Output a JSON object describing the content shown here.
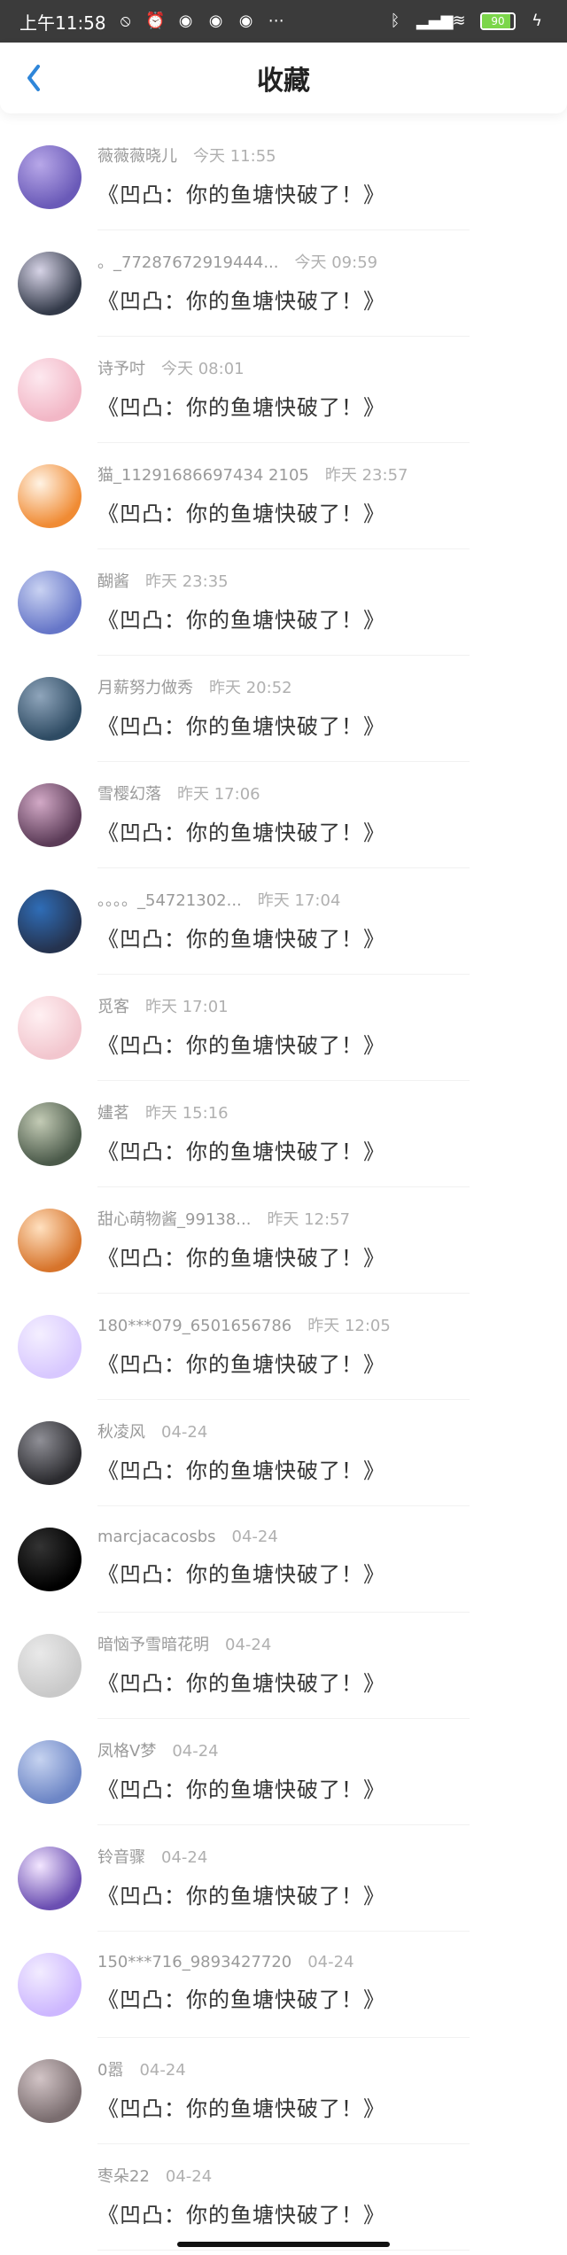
{
  "status_bar": {
    "time": "上午11:58",
    "battery_text": "90",
    "battery_level": 0.9,
    "left_icons": [
      "mute-icon",
      "alarm-icon",
      "app-icon-1",
      "app-icon-2",
      "app-icon-3",
      "more-dots-icon"
    ],
    "right_icons": [
      "bluetooth-icon",
      "signal-hd-icon",
      "wifi-icon",
      "battery-icon",
      "charging-icon"
    ]
  },
  "header": {
    "title": "收藏",
    "back_icon": "chevron-left-icon",
    "accent": "#2f86d9"
  },
  "items": [
    {
      "name": "薇薇薇晓儿",
      "time": "今天 11:55",
      "title": "《凹凸：你的鱼塘快破了！》",
      "avatar_colors": [
        "#6a5ab8",
        "#b7a7e8"
      ]
    },
    {
      "name": "。_77287672919444...",
      "time": "今天 09:59",
      "title": "《凹凸：你的鱼塘快破了！》",
      "avatar_colors": [
        "#333a49",
        "#d6d3e6"
      ]
    },
    {
      "name": "诗予吋",
      "time": "今天 08:01",
      "title": "《凹凸：你的鱼塘快破了！》",
      "avatar_colors": [
        "#f2b7c6",
        "#fde8ef"
      ]
    },
    {
      "name": "猫_11291686697434 2105",
      "time": "昨天 23:57",
      "title": "《凹凸：你的鱼塘快破了！》",
      "avatar_colors": [
        "#f08b34",
        "#fff3e4"
      ]
    },
    {
      "name": "醐酱",
      "time": "昨天 23:35",
      "title": "《凹凸：你的鱼塘快破了！》",
      "avatar_colors": [
        "#6676c8",
        "#c9d2f2"
      ]
    },
    {
      "name": "月薪努力做秀",
      "time": "昨天 20:52",
      "title": "《凹凸：你的鱼塘快破了！》",
      "avatar_colors": [
        "#2e4b63",
        "#8fa5bb"
      ]
    },
    {
      "name": "雪樱幻落",
      "time": "昨天 17:06",
      "title": "《凹凸：你的鱼塘快破了！》",
      "avatar_colors": [
        "#5b3b57",
        "#d2a9c6"
      ]
    },
    {
      "name": "。。。。_54721302...",
      "time": "昨天 17:04",
      "title": "《凹凸：你的鱼塘快破了！》",
      "avatar_colors": [
        "#25334f",
        "#2f6db7"
      ]
    },
    {
      "name": "觅客",
      "time": "昨天 17:01",
      "title": "《凹凸：你的鱼塘快破了！》",
      "avatar_colors": [
        "#f2c6ce",
        "#fff0f2"
      ]
    },
    {
      "name": "嫿茗",
      "time": "昨天 15:16",
      "title": "《凹凸：你的鱼塘快破了！》",
      "avatar_colors": [
        "#4b5a4a",
        "#c3cbb5"
      ]
    },
    {
      "name": "甜心萌物酱_99138...",
      "time": "昨天 12:57",
      "title": "《凹凸：你的鱼塘快破了！》",
      "avatar_colors": [
        "#d7742b",
        "#ffe0bf"
      ]
    },
    {
      "name": "180***079_6501656786",
      "time": "昨天 12:05",
      "title": "《凹凸：你的鱼塘快破了！》",
      "avatar_colors": [
        "#d8c8ff",
        "#f4efff"
      ]
    },
    {
      "name": "秋凌风",
      "time": "04-24",
      "title": "《凹凸：你的鱼塘快破了！》",
      "avatar_colors": [
        "#2b2b2f",
        "#8f8f96"
      ]
    },
    {
      "name": "marcjacacosbs",
      "time": "04-24",
      "title": "《凹凸：你的鱼塘快破了！》",
      "avatar_colors": [
        "#000000",
        "#333333"
      ]
    },
    {
      "name": "暗恼予雪暗花明",
      "time": "04-24",
      "title": "《凹凸：你的鱼塘快破了！》",
      "avatar_colors": [
        "#c9c9c9",
        "#e9e9e9"
      ]
    },
    {
      "name": "凤格V梦",
      "time": "04-24",
      "title": "《凹凸：你的鱼塘快破了！》",
      "avatar_colors": [
        "#6d86c6",
        "#c6d3f0"
      ]
    },
    {
      "name": "铃音骤",
      "time": "04-24",
      "title": "《凹凸：你的鱼塘快破了！》",
      "avatar_colors": [
        "#6b4fb2",
        "#f3e6ff"
      ]
    },
    {
      "name": "150***716_9893427720",
      "time": "04-24",
      "title": "《凹凸：你的鱼塘快破了！》",
      "avatar_colors": [
        "#cdb7ff",
        "#f2ecff"
      ]
    },
    {
      "name": "0嚣",
      "time": "04-24",
      "title": "《凹凸：你的鱼塘快破了！》",
      "avatar_colors": [
        "#7a6d6f",
        "#d2c4c6"
      ]
    },
    {
      "name": "枣朵22",
      "time": "04-24",
      "title": "《凹凸：你的鱼塘快破了！》",
      "avatar_colors": [
        "#ffffff",
        "#ffffff"
      ]
    }
  ]
}
